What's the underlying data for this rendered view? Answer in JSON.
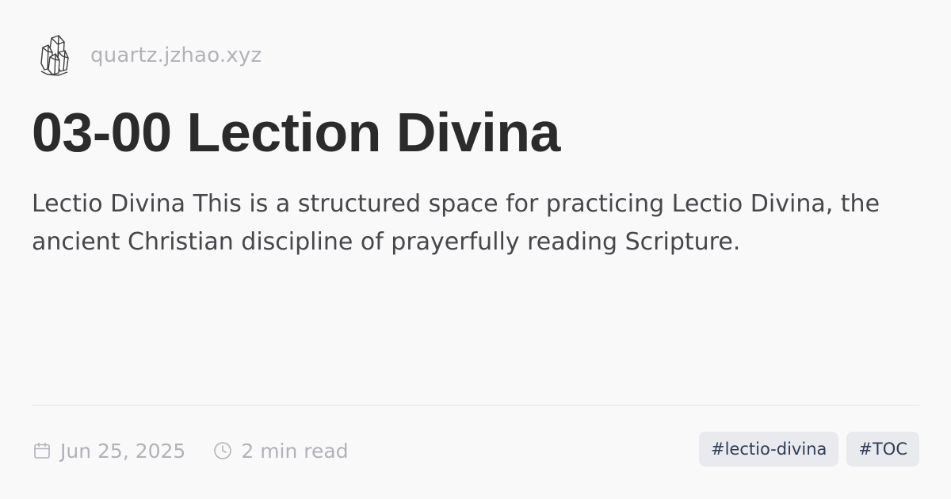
{
  "site": {
    "logo_icon": "crystal-icon",
    "name": "quartz.jzhao.xyz"
  },
  "page": {
    "title": "03-00 Lection Divina",
    "description": "Lectio Divina This is a structured space for practicing Lectio Divina, the ancient Christian discipline of prayerfully reading Scripture."
  },
  "meta": {
    "date_icon": "calendar-icon",
    "date": "Jun 25, 2025",
    "reading_time_icon": "clock-icon",
    "reading_time": "2 min read"
  },
  "tags": [
    {
      "label": "#lectio-divina"
    },
    {
      "label": "#TOC"
    }
  ],
  "colors": {
    "background": "#faf9fa",
    "title": "#2b2b2b",
    "body_text": "#46464b",
    "muted_text": "#b3b1b8",
    "tag_background": "#e9eaed",
    "tag_text": "#2f3d52"
  }
}
